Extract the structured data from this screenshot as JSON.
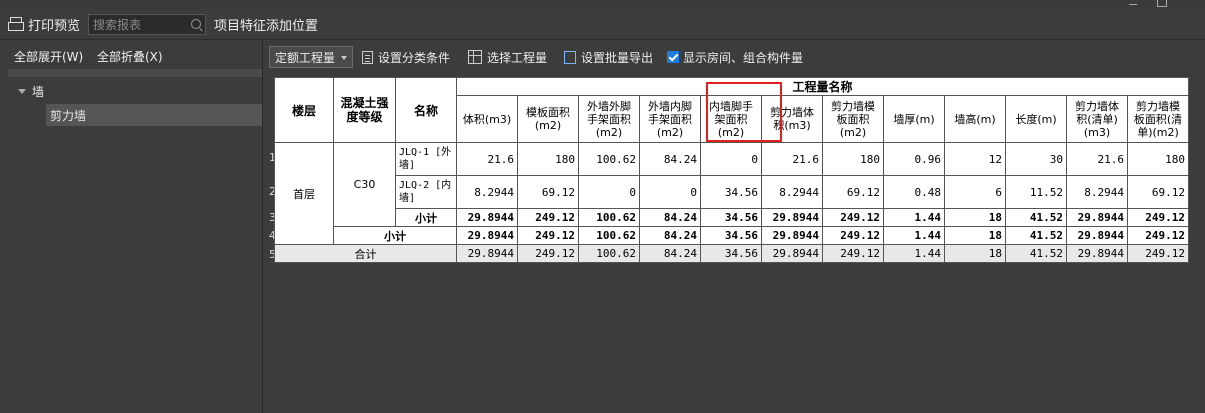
{
  "toolbar": {
    "print_preview": "打印预览",
    "search_placeholder": "搜索报表",
    "feature_position": "项目特征添加位置"
  },
  "left_panel": {
    "expand_all": "全部展开(W)",
    "collapse_all": "全部折叠(X)",
    "tree": [
      {
        "label": "墙",
        "expanded": true
      },
      {
        "label": "剪力墙",
        "selected": true
      }
    ]
  },
  "report_toolbar": {
    "dropdown_value": "定额工程量",
    "set_category": "设置分类条件",
    "select_quantity": "选择工程量",
    "set_batch_export": "设置批量导出",
    "show_rooms_label": "显示房间、组合构件量",
    "show_rooms_checked": true
  },
  "table": {
    "headers": {
      "floor": "楼层",
      "concrete_grade": "混凝土强度等级",
      "name": "名称",
      "quantity_group": "工程量名称",
      "columns": [
        "体积(m3)",
        "模板面积(m2)",
        "外墙外脚手架面积(m2)",
        "外墙内脚手架面积(m2)",
        "内墙脚手架面积(m2)",
        "剪力墙体积(m3)",
        "剪力墙模板面积(m2)",
        "墙厚(m)",
        "墙高(m)",
        "长度(m)",
        "剪力墙体积(清单)(m3)",
        "剪力墙模板面积(清单)(m2)"
      ]
    },
    "floor_value": "首层",
    "grade_value": "C30",
    "row_numbers": [
      "1",
      "2",
      "3",
      "4",
      "5"
    ],
    "rows": [
      {
        "name": "JLQ-1 [外墙]",
        "values": [
          "21.6",
          "180",
          "100.62",
          "84.24",
          "0",
          "21.6",
          "180",
          "0.96",
          "12",
          "30",
          "21.6",
          "180"
        ]
      },
      {
        "name": "JLQ-2 [内墙]",
        "values": [
          "8.2944",
          "69.12",
          "0",
          "0",
          "34.56",
          "8.2944",
          "69.12",
          "0.48",
          "6",
          "11.52",
          "8.2944",
          "69.12"
        ]
      }
    ],
    "subtotal_grade": {
      "label": "小计",
      "values": [
        "29.8944",
        "249.12",
        "100.62",
        "84.24",
        "34.56",
        "29.8944",
        "249.12",
        "1.44",
        "18",
        "41.52",
        "29.8944",
        "249.12"
      ]
    },
    "subtotal_floor": {
      "label": "小计",
      "values": [
        "29.8944",
        "249.12",
        "100.62",
        "84.24",
        "34.56",
        "29.8944",
        "249.12",
        "1.44",
        "18",
        "41.52",
        "29.8944",
        "249.12"
      ]
    },
    "total": {
      "label": "合计",
      "values": [
        "29.8944",
        "249.12",
        "100.62",
        "84.24",
        "34.56",
        "29.8944",
        "249.12",
        "1.44",
        "18",
        "41.52",
        "29.8944",
        "249.12"
      ]
    }
  },
  "colors": {
    "highlight": "#e02020",
    "checkbox": "#1e7be0"
  }
}
